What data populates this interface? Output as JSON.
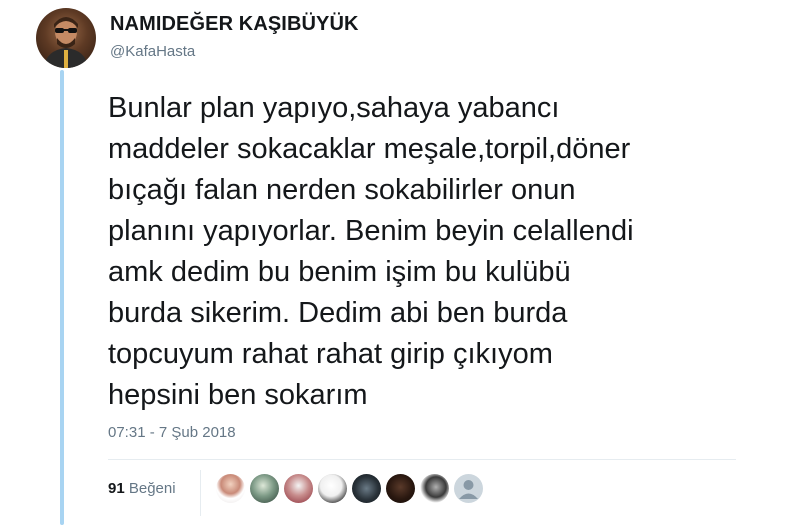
{
  "tweet": {
    "display_name": "NAMIDEĞER KAŞIBÜYÜK",
    "handle": "@KafaHasta",
    "text": "Bunlar plan yapıyo,sahaya yabancı\nmaddeler sokacaklar meşale,torpil,döner\nbıçağı falan nerden sokabilirler onun\nplanını yapıyorlar. Benim beyin celallendi\namk dedim bu benim işim bu kulübü\nburda sikerim. Dedim abi ben burda\ntopcuyum rahat rahat girip çıkıyom\nhepsini ben sokarım",
    "timestamp": "07:31 - 7 Şub 2018",
    "likes": {
      "count": "91",
      "label": "Beğeni"
    }
  },
  "likers": [
    {
      "icon": "liker-avatar"
    },
    {
      "icon": "liker-avatar"
    },
    {
      "icon": "liker-avatar"
    },
    {
      "icon": "liker-avatar"
    },
    {
      "icon": "liker-avatar"
    },
    {
      "icon": "liker-avatar"
    },
    {
      "icon": "liker-avatar"
    },
    {
      "icon": "default-avatar"
    }
  ],
  "colors": {
    "thread_line": "#a8d4f2",
    "secondary_text": "#657786",
    "primary_text": "#14171a",
    "divider": "#e6ecf0"
  }
}
